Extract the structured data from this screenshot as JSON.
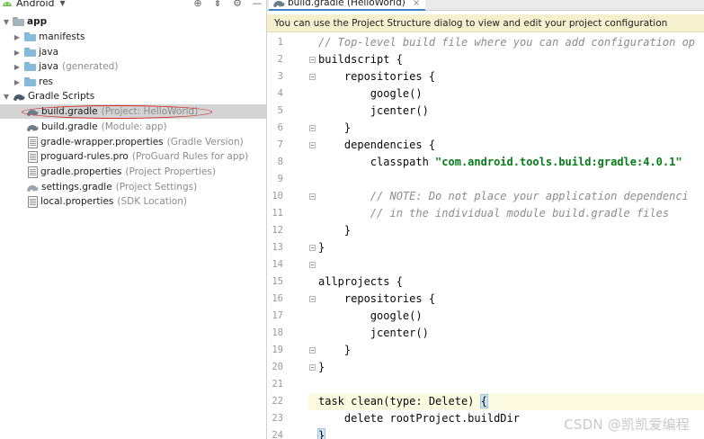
{
  "project_pane": {
    "view_label": "Android",
    "tree": [
      {
        "label": "app",
        "hint": "",
        "bold": true,
        "expanded": true,
        "icon": "folder-icon"
      },
      {
        "label": "manifests",
        "hint": "",
        "icon": "folder-icon"
      },
      {
        "label": "java",
        "hint": "",
        "icon": "folder-icon"
      },
      {
        "label": "java",
        "hint": "(generated)",
        "icon": "folder-icon"
      },
      {
        "label": "res",
        "hint": "",
        "icon": "folder-icon"
      },
      {
        "label": "Gradle Scripts",
        "hint": "",
        "expanded": true,
        "icon": "gradle-icon"
      },
      {
        "label": "build.gradle",
        "hint": "(Project: HelloWorld)",
        "selected": true,
        "icon": "gradle-icon"
      },
      {
        "label": "build.gradle",
        "hint": "(Module: app)",
        "icon": "gradle-icon"
      },
      {
        "label": "gradle-wrapper.properties",
        "hint": "(Gradle Version)",
        "icon": "properties-file-icon"
      },
      {
        "label": "proguard-rules.pro",
        "hint": "(ProGuard Rules for app)",
        "icon": "properties-file-icon"
      },
      {
        "label": "gradle.properties",
        "hint": "(Project Properties)",
        "icon": "properties-file-icon"
      },
      {
        "label": "settings.gradle",
        "hint": "(Project Settings)",
        "icon": "gradle-icon"
      },
      {
        "label": "local.properties",
        "hint": "(SDK Location)",
        "icon": "properties-file-icon"
      }
    ]
  },
  "editor": {
    "tab_label": "build.gradle (HelloWorld)",
    "tab_close": "×",
    "notification": "You can use the Project Structure dialog to view and edit your project configuration",
    "line_numbers": [
      "1",
      "2",
      "3",
      "4",
      "5",
      "6",
      "7",
      "8",
      "9",
      "10",
      "11",
      "12",
      "13",
      "14",
      "15",
      "16",
      "17",
      "18",
      "19",
      "20",
      "21",
      "22",
      "23",
      "24"
    ],
    "code": {
      "l1": "// Top-level build file where you can add configuration op",
      "l2": "buildscript {",
      "l3": "    repositories {",
      "l4": "        google()",
      "l5": "        jcenter()",
      "l6": "    }",
      "l7": "    dependencies {",
      "l8_pre": "        classpath ",
      "l8_str": "\"com.android.tools.build:gradle:4.0.1\"",
      "l9": "",
      "l10": "        // NOTE: Do not place your application dependenci",
      "l11": "        // in the individual module build.gradle files",
      "l12": "    }",
      "l13": "}",
      "l14": "",
      "l15": "allprojects {",
      "l16": "    repositories {",
      "l17": "        google()",
      "l18": "        jcenter()",
      "l19": "    }",
      "l20": "}",
      "l21": "",
      "l22_pre": "task clean(type: Delete) ",
      "l22_brace": "{",
      "l23": "    delete rootProject.buildDir",
      "l24": "}"
    }
  },
  "watermark": "CSDN @凯凯爱编程",
  "colors": {
    "selection": "#d4d4d4",
    "annotation": "#d42a2a",
    "notification_bg": "#f6f0cf",
    "string": "#067d17",
    "comment": "#8c8c8c",
    "current_line": "#fcfae1"
  }
}
